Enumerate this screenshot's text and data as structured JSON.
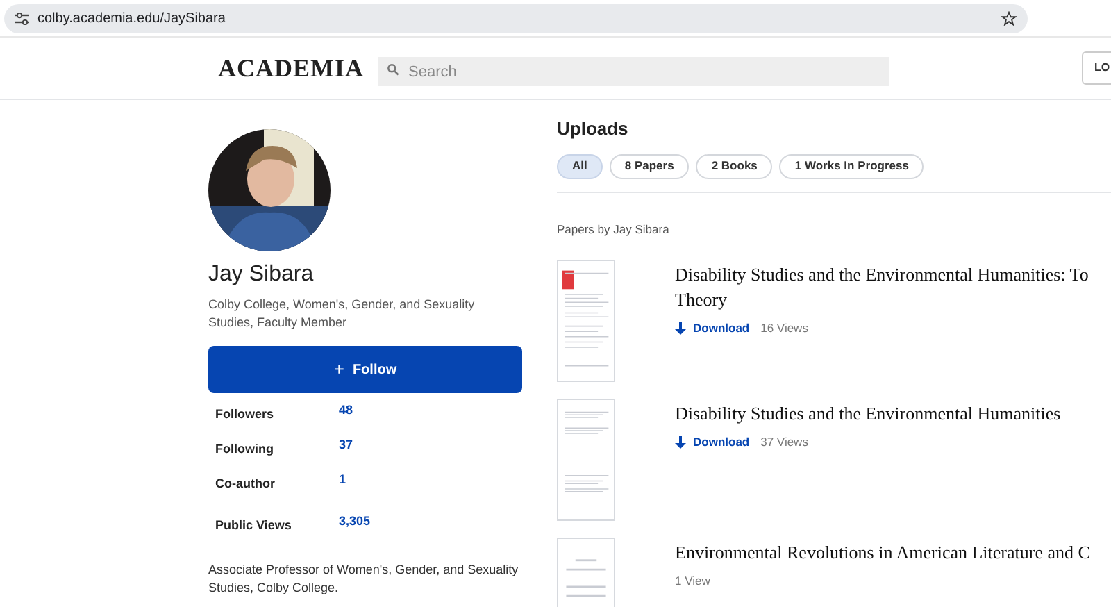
{
  "browser": {
    "url": "colby.academia.edu/JaySibara"
  },
  "header": {
    "logo": "ACADEMIA",
    "search": {
      "placeholder": "Search"
    },
    "login_button": "LO"
  },
  "profile": {
    "name": "Jay Sibara",
    "affiliation": "Colby College, Women's, Gender, and Sexuality Studies, Faculty Member",
    "follow_icon": "+",
    "follow_button": "Follow",
    "stats": [
      {
        "label": "Followers",
        "value": "48"
      },
      {
        "label": "Following",
        "value": "37"
      },
      {
        "label": "Co-author",
        "value": "1"
      },
      {
        "label": "Public Views",
        "value": "3,305"
      }
    ],
    "bio": "Associate Professor of Women's, Gender, and Sexuality Studies, Colby College."
  },
  "uploads": {
    "title": "Uploads",
    "filters": [
      {
        "label": "All",
        "selected": true
      },
      {
        "label": "8 Papers",
        "selected": false
      },
      {
        "label": "2 Books",
        "selected": false
      },
      {
        "label": "1 Works In Progress",
        "selected": false
      }
    ],
    "section_title": "Papers by Jay Sibara",
    "papers": [
      {
        "title_lines": [
          "Disability Studies and the Environmental Humanities: To",
          "Theory"
        ],
        "kind": "cover",
        "download": "Download",
        "views": "16 Views"
      },
      {
        "title_lines": [
          "Disability Studies and the Environmental Humanities"
        ],
        "kind": "text",
        "download": "Download",
        "views": "37 Views"
      },
      {
        "title_lines": [
          "Environmental Revolutions in American Literature and C"
        ],
        "kind": "placeholder",
        "views": "1 View"
      }
    ]
  }
}
